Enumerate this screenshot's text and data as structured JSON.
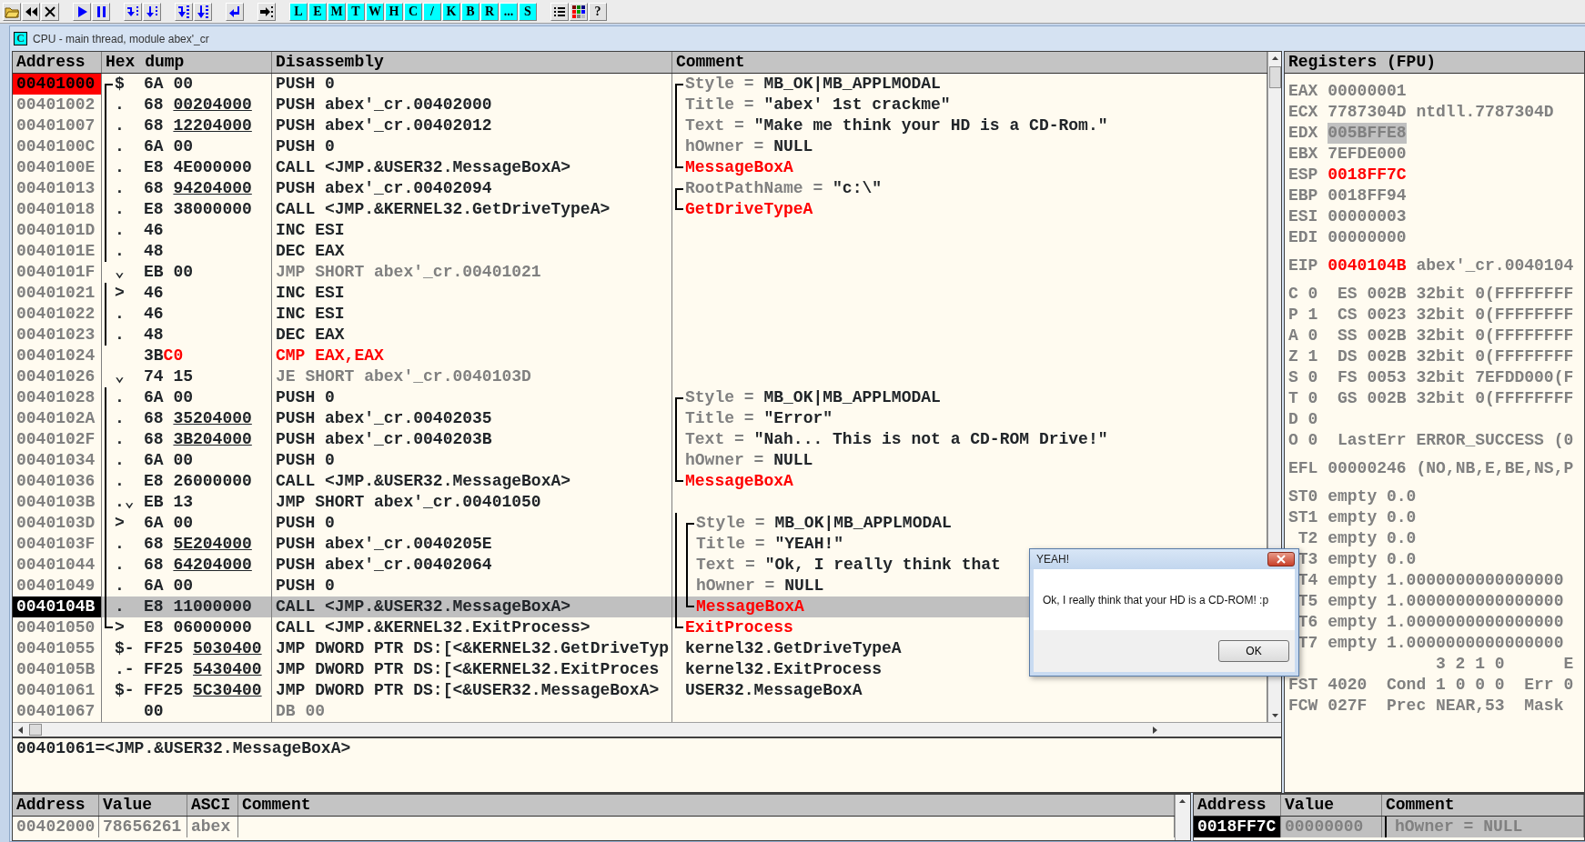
{
  "toolbar": {
    "letter_buttons": [
      "L",
      "E",
      "M",
      "T",
      "W",
      "H",
      "C",
      "/",
      "K",
      "B",
      "R",
      "...",
      "S"
    ],
    "help_button": "?"
  },
  "window": {
    "icon_letter": "C",
    "title": "CPU - main thread, module abex'_cr"
  },
  "disassembly": {
    "columns": [
      "Address",
      "Hex dump",
      "Disassembly",
      "Comment"
    ],
    "rows": [
      {
        "address": "00401000",
        "breakpoint": true,
        "eip": false,
        "selected": false,
        "hex_brackets": [
          {
            "kind": "top"
          }
        ],
        "marker": "$",
        "hex": [
          {
            "text": "6A 00",
            "kind": "plain"
          }
        ],
        "asm": "PUSH 0",
        "kind": "normal",
        "comment": [
          {
            "text": "Style = ",
            "kind": "label"
          },
          {
            "text": "MB_OK|MB_APPLMODAL",
            "kind": "value"
          }
        ],
        "comment_brackets": [
          {
            "kind": "top"
          }
        ]
      },
      {
        "address": "00401002",
        "breakpoint": false,
        "eip": false,
        "selected": false,
        "hex_brackets": [
          {
            "kind": "line"
          }
        ],
        "marker": ".",
        "hex": [
          {
            "text": "68 ",
            "kind": "plain"
          },
          {
            "text": "00204000",
            "kind": "fixup"
          }
        ],
        "asm": "PUSH abex'_cr.00402000",
        "kind": "normal",
        "comment": [
          {
            "text": "Title = ",
            "kind": "label"
          },
          {
            "text": "\"abex' 1st crackme\"",
            "kind": "value"
          }
        ],
        "comment_brackets": [
          {
            "kind": "line"
          }
        ]
      },
      {
        "address": "00401007",
        "breakpoint": false,
        "eip": false,
        "selected": false,
        "hex_brackets": [
          {
            "kind": "line"
          }
        ],
        "marker": ".",
        "hex": [
          {
            "text": "68 ",
            "kind": "plain"
          },
          {
            "text": "12204000",
            "kind": "fixup"
          }
        ],
        "asm": "PUSH abex'_cr.00402012",
        "kind": "normal",
        "comment": [
          {
            "text": "Text = ",
            "kind": "label"
          },
          {
            "text": "\"Make me think your HD is a CD-Rom.\"",
            "kind": "value"
          }
        ],
        "comment_brackets": [
          {
            "kind": "line"
          }
        ]
      },
      {
        "address": "0040100C",
        "breakpoint": false,
        "eip": false,
        "selected": false,
        "hex_brackets": [
          {
            "kind": "line"
          }
        ],
        "marker": ".",
        "hex": [
          {
            "text": "6A 00",
            "kind": "plain"
          }
        ],
        "asm": "PUSH 0",
        "kind": "normal",
        "comment": [
          {
            "text": "hOwner = ",
            "kind": "label"
          },
          {
            "text": "NULL",
            "kind": "value"
          }
        ],
        "comment_brackets": [
          {
            "kind": "line"
          }
        ]
      },
      {
        "address": "0040100E",
        "breakpoint": false,
        "eip": false,
        "selected": false,
        "hex_brackets": [
          {
            "kind": "line"
          }
        ],
        "marker": ".",
        "hex": [
          {
            "text": "E8 4E000000",
            "kind": "plain"
          }
        ],
        "asm": "CALL <JMP.&USER32.MessageBoxA>",
        "kind": "normal",
        "comment": [
          {
            "text": "MessageBoxA",
            "kind": "api"
          }
        ],
        "comment_brackets": [
          {
            "kind": "end"
          }
        ]
      },
      {
        "address": "00401013",
        "breakpoint": false,
        "eip": false,
        "selected": false,
        "hex_brackets": [
          {
            "kind": "line"
          }
        ],
        "marker": ".",
        "hex": [
          {
            "text": "68 ",
            "kind": "plain"
          },
          {
            "text": "94204000",
            "kind": "fixup"
          }
        ],
        "asm": "PUSH abex'_cr.00402094",
        "kind": "normal",
        "comment": [
          {
            "text": "RootPathName = ",
            "kind": "label"
          },
          {
            "text": "\"c:\\\"",
            "kind": "value"
          }
        ],
        "comment_brackets": [
          {
            "kind": "top"
          }
        ]
      },
      {
        "address": "00401018",
        "breakpoint": false,
        "eip": false,
        "selected": false,
        "hex_brackets": [
          {
            "kind": "line"
          }
        ],
        "marker": ".",
        "hex": [
          {
            "text": "E8 38000000",
            "kind": "plain"
          }
        ],
        "asm": "CALL <JMP.&KERNEL32.GetDriveTypeA>",
        "kind": "normal",
        "comment": [
          {
            "text": "GetDriveTypeA",
            "kind": "api"
          }
        ],
        "comment_brackets": [
          {
            "kind": "end"
          }
        ]
      },
      {
        "address": "0040101D",
        "breakpoint": false,
        "eip": false,
        "selected": false,
        "hex_brackets": [
          {
            "kind": "line"
          }
        ],
        "marker": ".",
        "hex": [
          {
            "text": "46",
            "kind": "plain"
          }
        ],
        "asm": "INC ESI",
        "kind": "normal"
      },
      {
        "address": "0040101E",
        "breakpoint": false,
        "eip": false,
        "selected": false,
        "hex_brackets": [
          {
            "kind": "line"
          }
        ],
        "marker": ".",
        "hex": [
          {
            "text": "48",
            "kind": "plain"
          }
        ],
        "asm": "DEC EAX",
        "kind": "normal"
      },
      {
        "address": "0040101F",
        "breakpoint": false,
        "eip": false,
        "selected": false,
        "marker": "⌄",
        "hex": [
          {
            "text": "EB 00",
            "kind": "plain"
          }
        ],
        "asm": "JMP SHORT abex'_cr.00401021",
        "kind": "dim"
      },
      {
        "address": "00401021",
        "breakpoint": false,
        "eip": false,
        "selected": false,
        "hex_brackets": [
          {
            "kind": "line"
          }
        ],
        "marker": ">",
        "hex": [
          {
            "text": "46",
            "kind": "plain"
          }
        ],
        "asm": "INC ESI",
        "kind": "normal"
      },
      {
        "address": "00401022",
        "breakpoint": false,
        "eip": false,
        "selected": false,
        "hex_brackets": [
          {
            "kind": "line"
          }
        ],
        "marker": ".",
        "hex": [
          {
            "text": "46",
            "kind": "plain"
          }
        ],
        "asm": "INC ESI",
        "kind": "normal"
      },
      {
        "address": "00401023",
        "breakpoint": false,
        "eip": false,
        "selected": false,
        "hex_brackets": [
          {
            "kind": "line"
          }
        ],
        "marker": ".",
        "hex": [
          {
            "text": "48",
            "kind": "plain"
          }
        ],
        "asm": "DEC EAX",
        "kind": "normal"
      },
      {
        "address": "00401024",
        "breakpoint": false,
        "eip": false,
        "selected": false,
        "hex": [
          {
            "text": "3B",
            "kind": "plain"
          },
          {
            "text": "C0",
            "kind": "patched"
          }
        ],
        "asm": "CMP EAX,EAX",
        "kind": "patched"
      },
      {
        "address": "00401026",
        "breakpoint": false,
        "eip": false,
        "selected": false,
        "marker": "⌄",
        "hex": [
          {
            "text": "74 15",
            "kind": "plain"
          }
        ],
        "asm": "JE SHORT abex'_cr.0040103D",
        "kind": "dim"
      },
      {
        "address": "00401028",
        "breakpoint": false,
        "eip": false,
        "selected": false,
        "hex_brackets": [
          {
            "kind": "line"
          }
        ],
        "marker": ".",
        "hex": [
          {
            "text": "6A 00",
            "kind": "plain"
          }
        ],
        "asm": "PUSH 0",
        "kind": "normal",
        "comment": [
          {
            "text": "Style = ",
            "kind": "label"
          },
          {
            "text": "MB_OK|MB_APPLMODAL",
            "kind": "value"
          }
        ],
        "comment_brackets": [
          {
            "kind": "top"
          }
        ]
      },
      {
        "address": "0040102A",
        "breakpoint": false,
        "eip": false,
        "selected": false,
        "hex_brackets": [
          {
            "kind": "line"
          }
        ],
        "marker": ".",
        "hex": [
          {
            "text": "68 ",
            "kind": "plain"
          },
          {
            "text": "35204000",
            "kind": "fixup"
          }
        ],
        "asm": "PUSH abex'_cr.00402035",
        "kind": "normal",
        "comment": [
          {
            "text": "Title = ",
            "kind": "label"
          },
          {
            "text": "\"Error\"",
            "kind": "value"
          }
        ],
        "comment_brackets": [
          {
            "kind": "line"
          }
        ]
      },
      {
        "address": "0040102F",
        "breakpoint": false,
        "eip": false,
        "selected": false,
        "hex_brackets": [
          {
            "kind": "line"
          }
        ],
        "marker": ".",
        "hex": [
          {
            "text": "68 ",
            "kind": "plain"
          },
          {
            "text": "3B204000",
            "kind": "fixup"
          }
        ],
        "asm": "PUSH abex'_cr.0040203B",
        "kind": "normal",
        "comment": [
          {
            "text": "Text = ",
            "kind": "label"
          },
          {
            "text": "\"Nah... This is not a CD-ROM Drive!\"",
            "kind": "value"
          }
        ],
        "comment_brackets": [
          {
            "kind": "line"
          }
        ]
      },
      {
        "address": "00401034",
        "breakpoint": false,
        "eip": false,
        "selected": false,
        "hex_brackets": [
          {
            "kind": "line"
          }
        ],
        "marker": ".",
        "hex": [
          {
            "text": "6A 00",
            "kind": "plain"
          }
        ],
        "asm": "PUSH 0",
        "kind": "normal",
        "comment": [
          {
            "text": "hOwner = ",
            "kind": "label"
          },
          {
            "text": "NULL",
            "kind": "value"
          }
        ],
        "comment_brackets": [
          {
            "kind": "line"
          }
        ]
      },
      {
        "address": "00401036",
        "breakpoint": false,
        "eip": false,
        "selected": false,
        "hex_brackets": [
          {
            "kind": "line"
          }
        ],
        "marker": ".",
        "hex": [
          {
            "text": "E8 26000000",
            "kind": "plain"
          }
        ],
        "asm": "CALL <JMP.&USER32.MessageBoxA>",
        "kind": "normal",
        "comment": [
          {
            "text": "MessageBoxA",
            "kind": "api"
          }
        ],
        "comment_brackets": [
          {
            "kind": "end"
          }
        ]
      },
      {
        "address": "0040103B",
        "breakpoint": false,
        "eip": false,
        "selected": false,
        "hex_brackets": [
          {
            "kind": "line"
          }
        ],
        "marker": ".⌄",
        "hex": [
          {
            "text": "EB 13",
            "kind": "plain"
          }
        ],
        "asm": "JMP SHORT abex'_cr.00401050",
        "kind": "normal"
      },
      {
        "address": "0040103D",
        "breakpoint": false,
        "eip": false,
        "selected": false,
        "hex_brackets": [
          {
            "kind": "line"
          }
        ],
        "marker": ">",
        "hex": [
          {
            "text": "6A 00",
            "kind": "plain"
          }
        ],
        "asm": "PUSH 0",
        "kind": "normal",
        "comment": [
          {
            "text": "Style = ",
            "kind": "label"
          },
          {
            "text": "MB_OK|MB_APPLMODAL",
            "kind": "value"
          }
        ],
        "comment_brackets": [
          {
            "kind": "line"
          },
          {
            "kind": "top"
          }
        ]
      },
      {
        "address": "0040103F",
        "breakpoint": false,
        "eip": false,
        "selected": false,
        "hex_brackets": [
          {
            "kind": "line"
          }
        ],
        "marker": ".",
        "hex": [
          {
            "text": "68 ",
            "kind": "plain"
          },
          {
            "text": "5E204000",
            "kind": "fixup"
          }
        ],
        "asm": "PUSH abex'_cr.0040205E",
        "kind": "normal",
        "comment": [
          {
            "text": "Title = ",
            "kind": "label"
          },
          {
            "text": "\"YEAH!\"",
            "kind": "value"
          }
        ],
        "comment_brackets": [
          {
            "kind": "line"
          },
          {
            "kind": "line"
          }
        ]
      },
      {
        "address": "00401044",
        "breakpoint": false,
        "eip": false,
        "selected": false,
        "hex_brackets": [
          {
            "kind": "line"
          }
        ],
        "marker": ".",
        "hex": [
          {
            "text": "68 ",
            "kind": "plain"
          },
          {
            "text": "64204000",
            "kind": "fixup"
          }
        ],
        "asm": "PUSH abex'_cr.00402064",
        "kind": "normal",
        "comment": [
          {
            "text": "Text = ",
            "kind": "label"
          },
          {
            "text": "\"Ok, I really think that",
            "kind": "value"
          }
        ],
        "comment_brackets": [
          {
            "kind": "line"
          },
          {
            "kind": "line"
          }
        ]
      },
      {
        "address": "00401049",
        "breakpoint": false,
        "eip": false,
        "selected": false,
        "hex_brackets": [
          {
            "kind": "line"
          }
        ],
        "marker": ".",
        "hex": [
          {
            "text": "6A 00",
            "kind": "plain"
          }
        ],
        "asm": "PUSH 0",
        "kind": "normal",
        "comment": [
          {
            "text": "hOwner = ",
            "kind": "label"
          },
          {
            "text": "NULL",
            "kind": "value"
          }
        ],
        "comment_brackets": [
          {
            "kind": "line"
          },
          {
            "kind": "line"
          }
        ]
      },
      {
        "address": "0040104B",
        "breakpoint": false,
        "eip": true,
        "selected": true,
        "hex_brackets": [
          {
            "kind": "line"
          }
        ],
        "marker": ".",
        "hex": [
          {
            "text": "E8 11000000",
            "kind": "plain"
          }
        ],
        "asm": "CALL <JMP.&USER32.MessageBoxA>",
        "kind": "normal",
        "comment": [
          {
            "text": "MessageBoxA",
            "kind": "api"
          }
        ],
        "comment_brackets": [
          {
            "kind": "line"
          },
          {
            "kind": "end"
          }
        ]
      },
      {
        "address": "00401050",
        "breakpoint": false,
        "eip": false,
        "selected": false,
        "hex_brackets": [
          {
            "kind": "end"
          }
        ],
        "marker": ">",
        "hex": [
          {
            "text": "E8 06000000",
            "kind": "plain"
          }
        ],
        "asm": "CALL <JMP.&KERNEL32.ExitProcess>",
        "kind": "normal",
        "comment": [
          {
            "text": "ExitProcess",
            "kind": "api"
          }
        ],
        "comment_brackets": [
          {
            "kind": "end"
          }
        ]
      },
      {
        "address": "00401055",
        "breakpoint": false,
        "eip": false,
        "selected": false,
        "marker": "$-",
        "hex": [
          {
            "text": "FF25 ",
            "kind": "plain"
          },
          {
            "text": "5030400",
            "kind": "fixup"
          }
        ],
        "asm": "JMP DWORD PTR DS:[<&KERNEL32.GetDriveTyp",
        "kind": "normal",
        "comment": [
          {
            "text": "kernel32.GetDriveTypeA",
            "kind": "value"
          }
        ]
      },
      {
        "address": "0040105B",
        "breakpoint": false,
        "eip": false,
        "selected": false,
        "marker": ".-",
        "hex": [
          {
            "text": "FF25 ",
            "kind": "plain"
          },
          {
            "text": "5430400",
            "kind": "fixup"
          }
        ],
        "asm": "JMP DWORD PTR DS:[<&KERNEL32.ExitProces",
        "kind": "normal",
        "comment": [
          {
            "text": "kernel32.ExitProcess",
            "kind": "value"
          }
        ]
      },
      {
        "address": "00401061",
        "breakpoint": false,
        "eip": false,
        "selected": false,
        "marker": "$-",
        "hex": [
          {
            "text": "FF25 ",
            "kind": "plain"
          },
          {
            "text": "5C30400",
            "kind": "fixup"
          }
        ],
        "asm": "JMP DWORD PTR DS:[<&USER32.MessageBoxA>",
        "kind": "normal",
        "comment": [
          {
            "text": "USER32.MessageBoxA",
            "kind": "value"
          }
        ]
      },
      {
        "address": "00401067",
        "breakpoint": false,
        "eip": false,
        "selected": false,
        "hex": [
          {
            "text": "00",
            "kind": "plain"
          }
        ],
        "asm": "DB 00",
        "kind": "dim"
      }
    ]
  },
  "info": "00401061=<JMP.&USER32.MessageBoxA>",
  "registers": {
    "title": "Registers (FPU)",
    "groups": [
      [
        {
          "kind": "reg",
          "name": "EAX",
          "value": "00000001",
          "changed": false,
          "selected": false
        },
        {
          "kind": "reg",
          "name": "ECX",
          "value": "7787304D",
          "comment": "ntdll.7787304D",
          "changed": false,
          "selected": false
        },
        {
          "kind": "reg",
          "name": "EDX",
          "value": "005BFFE8",
          "changed": false,
          "selected": true
        },
        {
          "kind": "reg",
          "name": "EBX",
          "value": "7EFDE000",
          "changed": false,
          "selected": false
        },
        {
          "kind": "reg",
          "name": "ESP",
          "value": "0018FF7C",
          "changed": true,
          "selected": false
        },
        {
          "kind": "reg",
          "name": "EBP",
          "value": "0018FF94",
          "changed": false,
          "selected": false
        },
        {
          "kind": "reg",
          "name": "ESI",
          "value": "00000003",
          "changed": false,
          "selected": false
        },
        {
          "kind": "reg",
          "name": "EDI",
          "value": "00000000",
          "changed": false,
          "selected": false
        }
      ],
      [
        {
          "kind": "reg",
          "name": "EIP",
          "value": "0040104B",
          "comment": "abex'_cr.0040104",
          "changed": true,
          "selected": false
        }
      ],
      [
        {
          "kind": "flag",
          "flag": "C",
          "bit": "0",
          "text": "ES 002B 32bit 0(FFFFFFFF"
        },
        {
          "kind": "flag",
          "flag": "P",
          "bit": "1",
          "text": "CS 0023 32bit 0(FFFFFFFF"
        },
        {
          "kind": "flag",
          "flag": "A",
          "bit": "0",
          "text": "SS 002B 32bit 0(FFFFFFFF"
        },
        {
          "kind": "flag",
          "flag": "Z",
          "bit": "1",
          "text": "DS 002B 32bit 0(FFFFFFFF"
        },
        {
          "kind": "flag",
          "flag": "S",
          "bit": "0",
          "text": "FS 0053 32bit 7EFDD000(F"
        },
        {
          "kind": "flag",
          "flag": "T",
          "bit": "0",
          "text": "GS 002B 32bit 0(FFFFFFFF"
        },
        {
          "kind": "flag",
          "flag": "D",
          "bit": "0"
        },
        {
          "kind": "flag",
          "flag": "O",
          "bit": "0",
          "text": "LastErr ERROR_SUCCESS (0"
        }
      ],
      [
        {
          "kind": "reg",
          "name": "EFL",
          "value": "00000246",
          "comment": "(NO,NB,E,BE,NS,P",
          "changed": false,
          "selected": false
        }
      ],
      [
        {
          "kind": "text",
          "text": "ST0 empty 0.0"
        },
        {
          "kind": "text",
          "text": "ST1 empty 0.0"
        },
        {
          "kind": "covered",
          "text": "T2 empty 0.0"
        },
        {
          "kind": "covered",
          "text": "T3 empty 0.0"
        },
        {
          "kind": "covered",
          "text": "T4 empty 1.0000000000000000"
        },
        {
          "kind": "covered",
          "text": "T5 empty 1.0000000000000000"
        },
        {
          "kind": "covered",
          "text": "T6 empty 1.0000000000000000"
        },
        {
          "kind": "covered",
          "text": "T7 empty 1.0000000000000000"
        },
        {
          "kind": "heading",
          "text": "3 2 1 0      E"
        },
        {
          "kind": "text",
          "text": "FST 4020  Cond 1 0 0 0  Err 0"
        },
        {
          "kind": "text",
          "text": "FCW 027F  Prec NEAR,53  Mask"
        }
      ]
    ]
  },
  "dump": {
    "columns": [
      "Address",
      "Value",
      "ASCI",
      "Comment"
    ],
    "rows": [
      {
        "address": "00402000",
        "value": "78656261",
        "ascii": "abex"
      }
    ]
  },
  "stack": {
    "columns": [
      "Address",
      "Value",
      "Comment"
    ],
    "rows": [
      {
        "address": "0018FF7C",
        "value": "00000000",
        "comment": "hOwner = NULL",
        "esp": true,
        "selected": true
      }
    ]
  },
  "dialog": {
    "title": "YEAH!",
    "message": "Ok, I really think that your HD is a CD-ROM! :p",
    "button": "OK"
  }
}
